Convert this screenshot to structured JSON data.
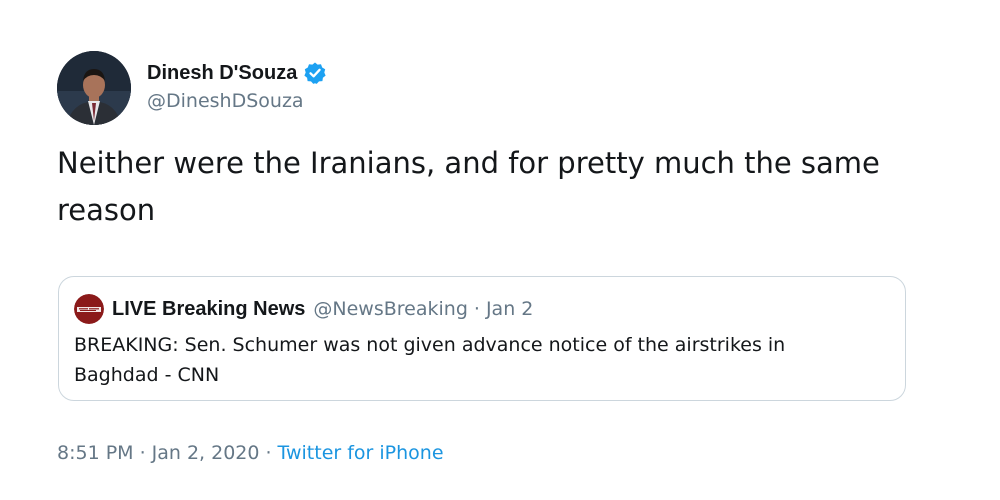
{
  "author": {
    "display_name": "Dinesh D'Souza",
    "handle": "@DineshDSouza",
    "verified": true,
    "avatar_icon": "profile-photo"
  },
  "tweet": {
    "text": "Neither were the Iranians, and for pretty much the same reason"
  },
  "quoted_tweet": {
    "display_name": "LIVE Breaking News",
    "handle": "@NewsBreaking",
    "separator": "·",
    "date": "Jan 2",
    "text": "BREAKING: Sen. Schumer was not given advance notice of the airstrikes in Baghdad - CNN",
    "avatar_icon": "news-logo"
  },
  "meta": {
    "time": "8:51 PM",
    "separator": "·",
    "date": "Jan 2, 2020",
    "separator2": "·",
    "source": "Twitter for iPhone"
  },
  "colors": {
    "text_primary": "#14171a",
    "text_secondary": "#657786",
    "link": "#1b95e0",
    "verified": "#1da1f2",
    "border": "#ccd6dd"
  }
}
